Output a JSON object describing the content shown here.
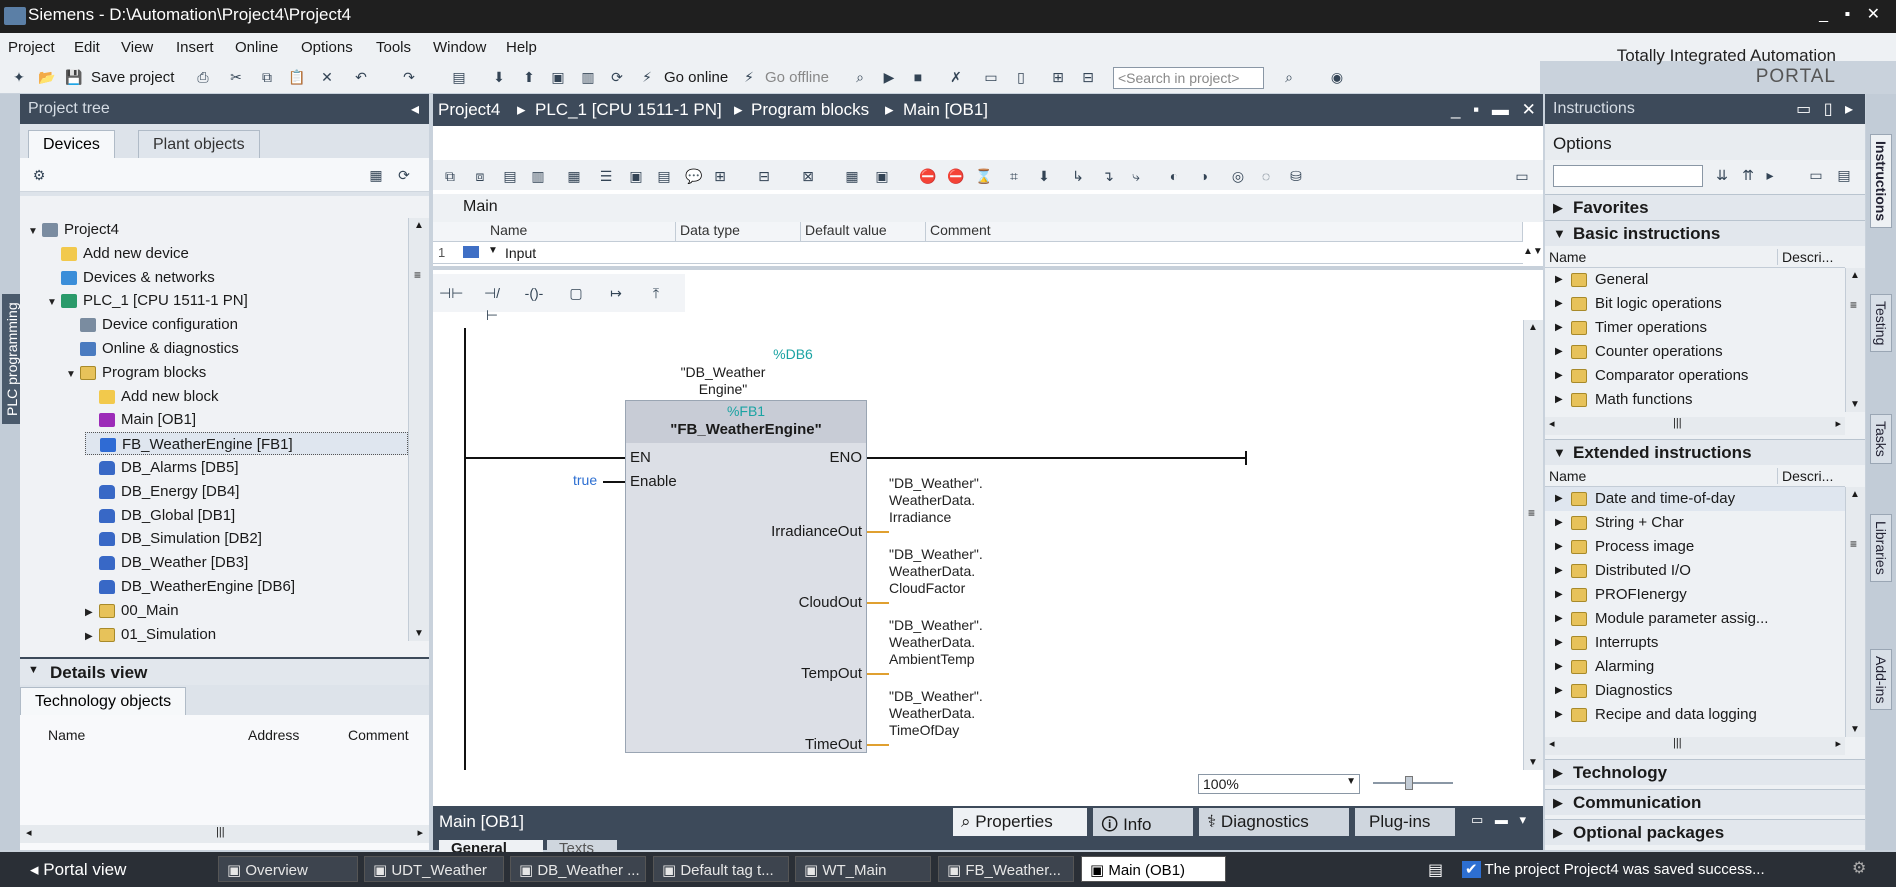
{
  "window": {
    "title": "Siemens - D:\\Automation\\Project4\\Project4",
    "controls": "_ ▪ ✕"
  },
  "menu": [
    "Project",
    "Edit",
    "View",
    "Insert",
    "Online",
    "Options",
    "Tools",
    "Window",
    "Help"
  ],
  "brand": {
    "line1": "Totally Integrated Automation",
    "line2": "PORTAL"
  },
  "toolbar": {
    "save_label": "Save project",
    "go_online": "Go online",
    "go_offline": "Go offline",
    "search_placeholder": "<Search in project>"
  },
  "left": {
    "title": "Project tree",
    "vertical_tab": "PLC programming",
    "tabs": [
      "Devices",
      "Plant objects"
    ],
    "tree": [
      {
        "label": "Project4",
        "icon": "project-icon",
        "level": 0,
        "caret": "▼"
      },
      {
        "label": "Add new device",
        "icon": "add-device-icon",
        "level": 1,
        "caret": ""
      },
      {
        "label": "Devices & networks",
        "icon": "network-icon",
        "level": 1,
        "caret": ""
      },
      {
        "label": "PLC_1 [CPU 1511-1 PN]",
        "icon": "plc-icon",
        "level": 1,
        "caret": "▼"
      },
      {
        "label": "Device configuration",
        "icon": "device-config-icon",
        "level": 2,
        "caret": ""
      },
      {
        "label": "Online & diagnostics",
        "icon": "diagnostics-icon",
        "level": 2,
        "caret": ""
      },
      {
        "label": "Program blocks",
        "icon": "folder-icon",
        "level": 2,
        "caret": "▼"
      },
      {
        "label": "Add new block",
        "icon": "add-block-icon",
        "level": 3,
        "caret": ""
      },
      {
        "label": "Main [OB1]",
        "icon": "ob-icon",
        "level": 3,
        "caret": ""
      },
      {
        "label": "FB_WeatherEngine [FB1]",
        "icon": "fb-icon",
        "level": 3,
        "caret": ""
      },
      {
        "label": "DB_Alarms [DB5]",
        "icon": "db-icon",
        "level": 3,
        "caret": ""
      },
      {
        "label": "DB_Energy [DB4]",
        "icon": "db-icon",
        "level": 3,
        "caret": ""
      },
      {
        "label": "DB_Global [DB1]",
        "icon": "db-icon",
        "level": 3,
        "caret": ""
      },
      {
        "label": "DB_Simulation [DB2]",
        "icon": "db-icon",
        "level": 3,
        "caret": ""
      },
      {
        "label": "DB_Weather [DB3]",
        "icon": "db-icon",
        "level": 3,
        "caret": ""
      },
      {
        "label": "DB_WeatherEngine [DB6]",
        "icon": "db-icon",
        "level": 3,
        "caret": ""
      },
      {
        "label": "00_Main",
        "icon": "group-folder-icon",
        "level": 3,
        "caret": "▶"
      },
      {
        "label": "01_Simulation",
        "icon": "group-folder-icon",
        "level": 3,
        "caret": "▶"
      }
    ],
    "details": {
      "title": "Details view",
      "tab": "Technology objects",
      "cols": [
        "Name",
        "Address",
        "Comment"
      ]
    }
  },
  "center": {
    "breadcrumb": [
      "Project4",
      "PLC_1 [CPU 1511-1 PN]",
      "Program blocks",
      "Main [OB1]"
    ],
    "block_name": "Main",
    "interface_cols": [
      "Name",
      "Data type",
      "Default value",
      "Comment"
    ],
    "interface_row": {
      "num": "1",
      "name": "Input"
    },
    "block": {
      "db_addr": "%DB6",
      "db_name_l1": "\"DB_Weather",
      "db_name_l2": "Engine\"",
      "fb_addr": "%FB1",
      "fb_name": "\"FB_WeatherEngine\"",
      "en": "EN",
      "eno": "ENO",
      "enable_val": "true",
      "enable": "Enable",
      "outputs": [
        {
          "pin": "IrradianceOut",
          "l1": "\"DB_Weather\".",
          "l2": "WeatherData.",
          "l3": "Irradiance"
        },
        {
          "pin": "CloudOut",
          "l1": "\"DB_Weather\".",
          "l2": "WeatherData.",
          "l3": "CloudFactor"
        },
        {
          "pin": "TempOut",
          "l1": "\"DB_Weather\".",
          "l2": "WeatherData.",
          "l3": "AmbientTemp"
        },
        {
          "pin": "TimeOut",
          "l1": "\"DB_Weather\".",
          "l2": "WeatherData.",
          "l3": "TimeOfDay"
        }
      ]
    },
    "zoom": "100%",
    "bottom": {
      "title": "Main [OB1]",
      "tabs": [
        "Properties",
        "Info",
        "Diagnostics",
        "Plug-ins"
      ],
      "subtabs": [
        "General",
        "Texts"
      ]
    }
  },
  "right": {
    "title": "Instructions",
    "options": "Options",
    "favorites": "Favorites",
    "basic": "Basic instructions",
    "name_col": "Name",
    "desc_col": "Descri...",
    "basic_items": [
      "General",
      "Bit logic operations",
      "Timer operations",
      "Counter operations",
      "Comparator operations",
      "Math functions"
    ],
    "extended": "Extended instructions",
    "extended_items": [
      "Date and time-of-day",
      "String + Char",
      "Process image",
      "Distributed I/O",
      "PROFIenergy",
      "Module parameter assig...",
      "Interrupts",
      "Alarming",
      "Diagnostics",
      "Recipe and data logging"
    ],
    "technology": "Technology",
    "communication": "Communication",
    "optional": "Optional packages",
    "vertical_tabs": [
      "Instructions",
      "Testing",
      "Tasks",
      "Libraries",
      "Add-ins"
    ]
  },
  "taskbar": {
    "portal_view": "Portal view",
    "tasks": [
      "Overview",
      "UDT_Weather",
      "DB_Weather ...",
      "Default tag t...",
      "WT_Main",
      "FB_Weather...",
      "Main (OB1)"
    ],
    "status": "The project Project4 was saved success..."
  }
}
